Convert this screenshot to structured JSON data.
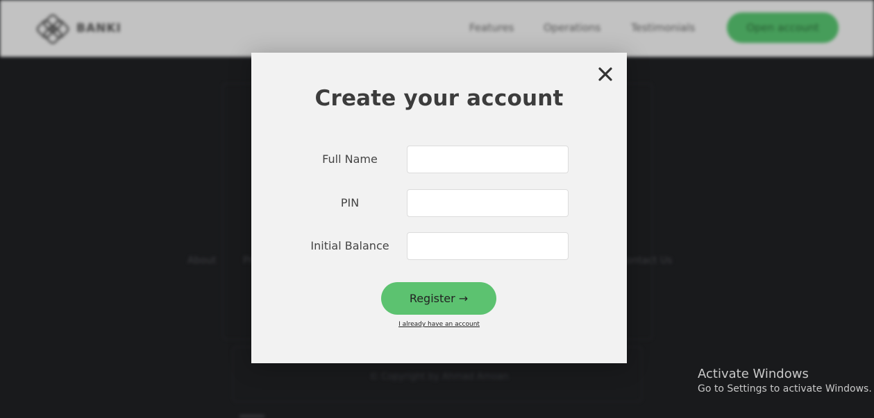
{
  "background": {
    "brand": "BANKI",
    "nav": {
      "features": "Features",
      "operations": "Operations",
      "testimonials": "Testimonials",
      "open_account": "Open account"
    },
    "footer": {
      "about": "About",
      "pricing": "Pricing",
      "contact": "Contact Us",
      "copyright": "© Copyright by Ahmad Amoan"
    }
  },
  "modal": {
    "title": "Create your account",
    "close_icon": "close-icon",
    "fields": [
      {
        "label": "Full Name",
        "value": "",
        "placeholder": ""
      },
      {
        "label": "PIN",
        "value": "",
        "placeholder": ""
      },
      {
        "label": "Initial Balance",
        "value": "",
        "placeholder": ""
      }
    ],
    "register_label": "Register →",
    "login_link": "I already have an account"
  },
  "watermark": {
    "title": "Activate Windows",
    "subtitle": "Go to Settings to activate Windows."
  },
  "colors": {
    "accent": "#5cc270",
    "modal_bg": "#f2f2f2",
    "page_bg": "#1f2023",
    "title": "#3c3c3c"
  }
}
